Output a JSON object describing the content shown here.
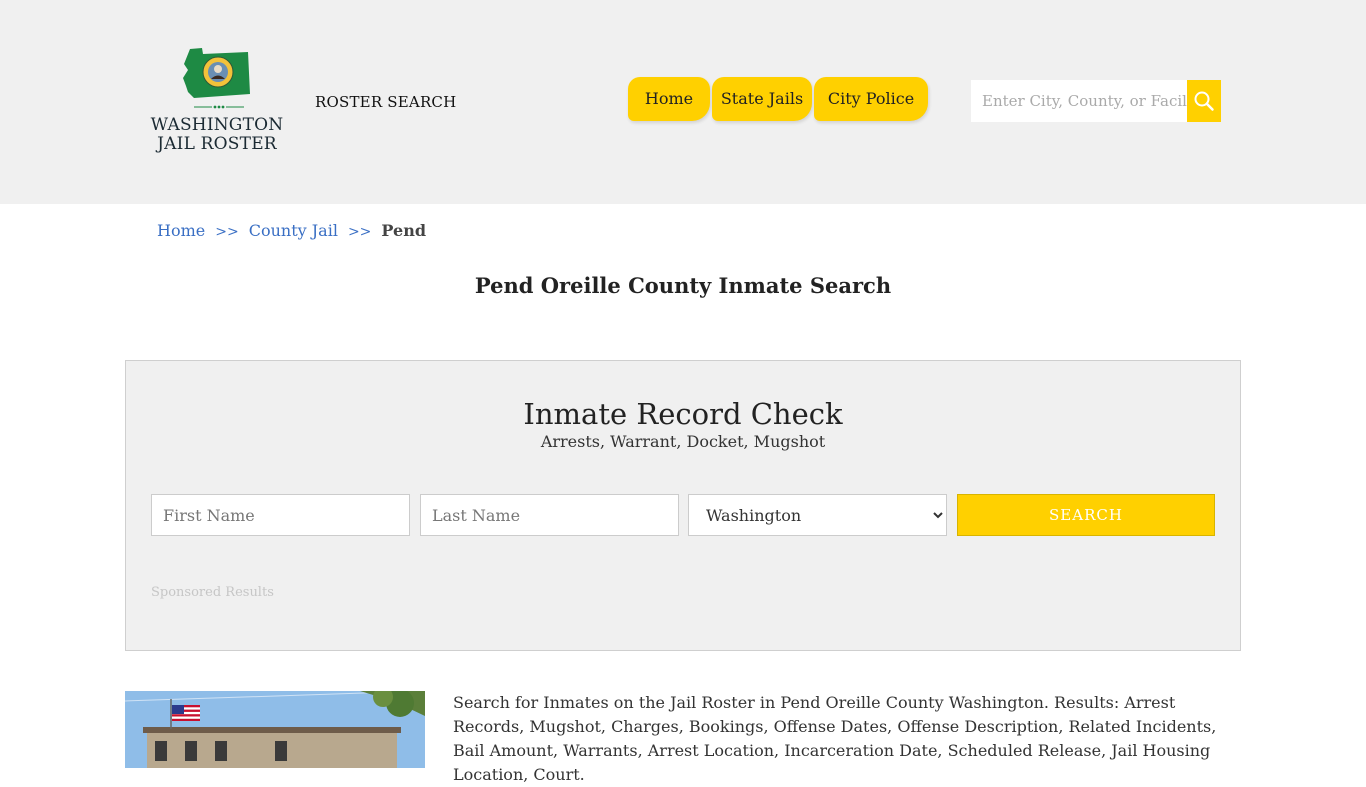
{
  "header": {
    "logo": {
      "line1": "WASHINGTON",
      "line2": "JAIL ROSTER",
      "flag_color": "#1e8a44"
    },
    "roster_search": "ROSTER SEARCH",
    "nav": [
      {
        "label": "Home"
      },
      {
        "label": "State Jails"
      },
      {
        "label": "City Police"
      }
    ],
    "search": {
      "placeholder": "Enter City, County, or Facility",
      "icon": "search-icon"
    }
  },
  "breadcrumb": {
    "items": [
      "Home",
      "County Jail"
    ],
    "separator": ">>",
    "current": "Pend"
  },
  "page_title": "Pend Oreille County Inmate Search",
  "record_check": {
    "title": "Inmate Record Check",
    "subtitle": "Arrests, Warrant, Docket, Mugshot",
    "first_name_placeholder": "First Name",
    "last_name_placeholder": "Last Name",
    "state_selected": "Washington",
    "submit_label": "SEARCH",
    "sponsored": "Sponsored Results"
  },
  "description": "Search for Inmates on the Jail Roster in Pend Oreille County Washington. Results: Arrest Records, Mugshot, Charges, Bookings, Offense Dates, Offense Description, Related Incidents, Bail Amount, Warrants, Arrest Location, Incarceration Date, Scheduled Release, Jail Housing Location, Court.",
  "colors": {
    "accent": "#ffd000",
    "link": "#3a6fc4",
    "header_bg": "#f0f0f0"
  }
}
